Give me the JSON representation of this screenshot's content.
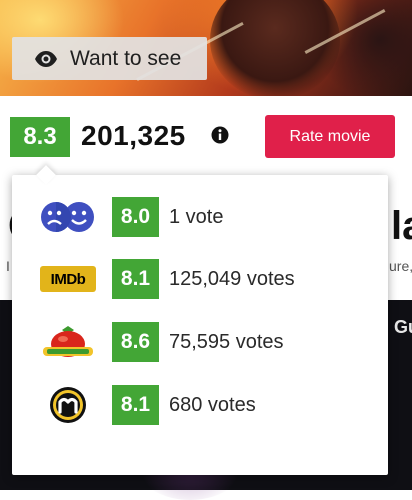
{
  "hero": {
    "want_to_see_label": "Want to see",
    "icon": "eye-icon"
  },
  "rating": {
    "score": "8.3",
    "vote_count": "201,325",
    "info_icon": "info-icon",
    "rate_button_label": "Rate movie"
  },
  "background": {
    "title_left": "C",
    "title_right": "la",
    "sub_left": "I",
    "sub_right": "ure,",
    "side_text": "Gu"
  },
  "popover": {
    "sources": [
      {
        "name": "community-logo",
        "score": "8.0",
        "votes": "1 vote"
      },
      {
        "name": "imdb-logo",
        "logo_text": "IMDb",
        "score": "8.1",
        "votes": "125,049 votes"
      },
      {
        "name": "rotten-tomatoes-logo",
        "score": "8.6",
        "votes": "75,595 votes"
      },
      {
        "name": "metacritic-logo",
        "score": "8.1",
        "votes": "680 votes"
      }
    ]
  },
  "colors": {
    "score_green": "#43a636",
    "rate_red": "#e0204a",
    "imdb_yellow": "#e2b41a"
  }
}
